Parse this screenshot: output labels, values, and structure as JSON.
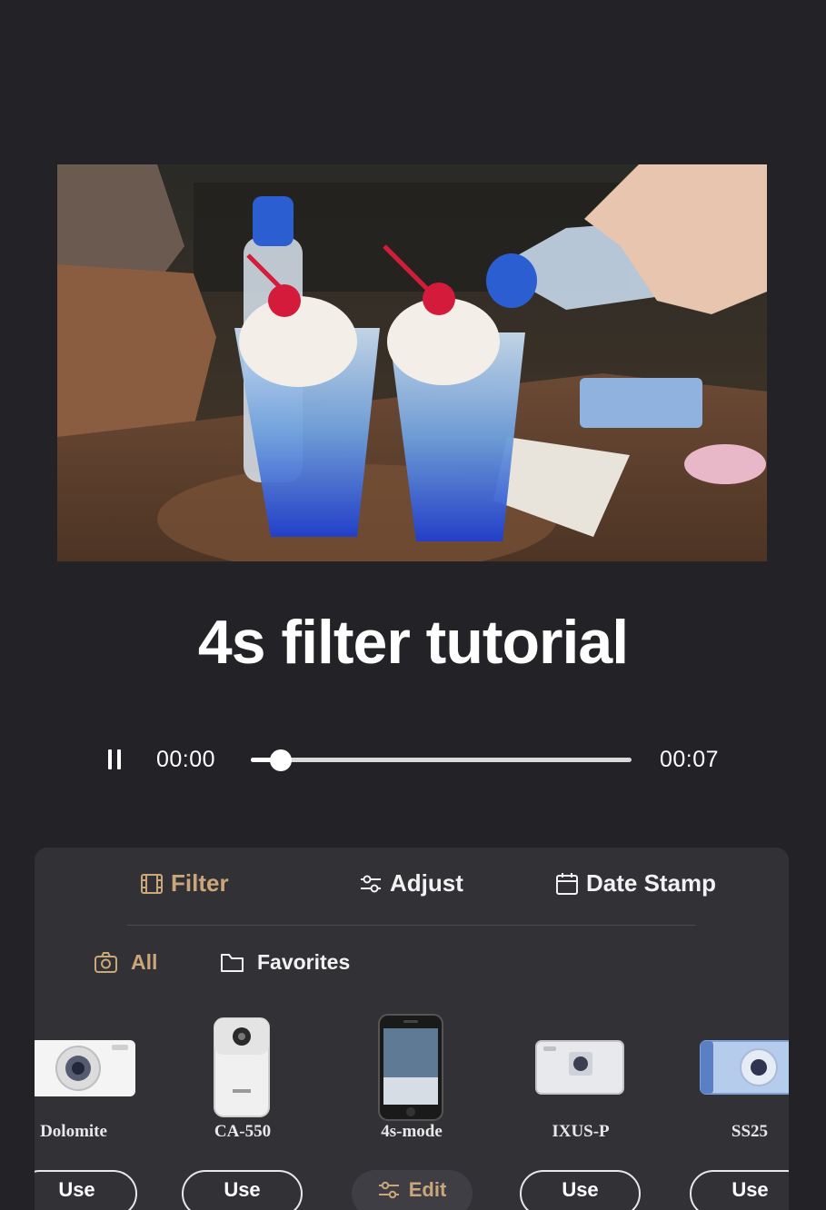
{
  "video": {
    "title": "4s filter tutorial",
    "current_time": "00:00",
    "duration": "00:07",
    "progress": 0.078,
    "state": "playing"
  },
  "tabs": {
    "filter": "Filter",
    "adjust": "Adjust",
    "date_stamp": "Date Stamp",
    "active": "filter"
  },
  "subtabs": {
    "all": "All",
    "favorites": "Favorites",
    "active": "all"
  },
  "filters": [
    {
      "name": "Dolomite",
      "button": "Use"
    },
    {
      "name": "CA-550",
      "button": "Use"
    },
    {
      "name": "4s-mode",
      "button": "Edit",
      "selected": true
    },
    {
      "name": "IXUS-P",
      "button": "Use"
    },
    {
      "name": "SS25",
      "button": "Use"
    }
  ],
  "colors": {
    "background": "#232226",
    "panel": "#323136",
    "accent": "#c9a77a"
  }
}
